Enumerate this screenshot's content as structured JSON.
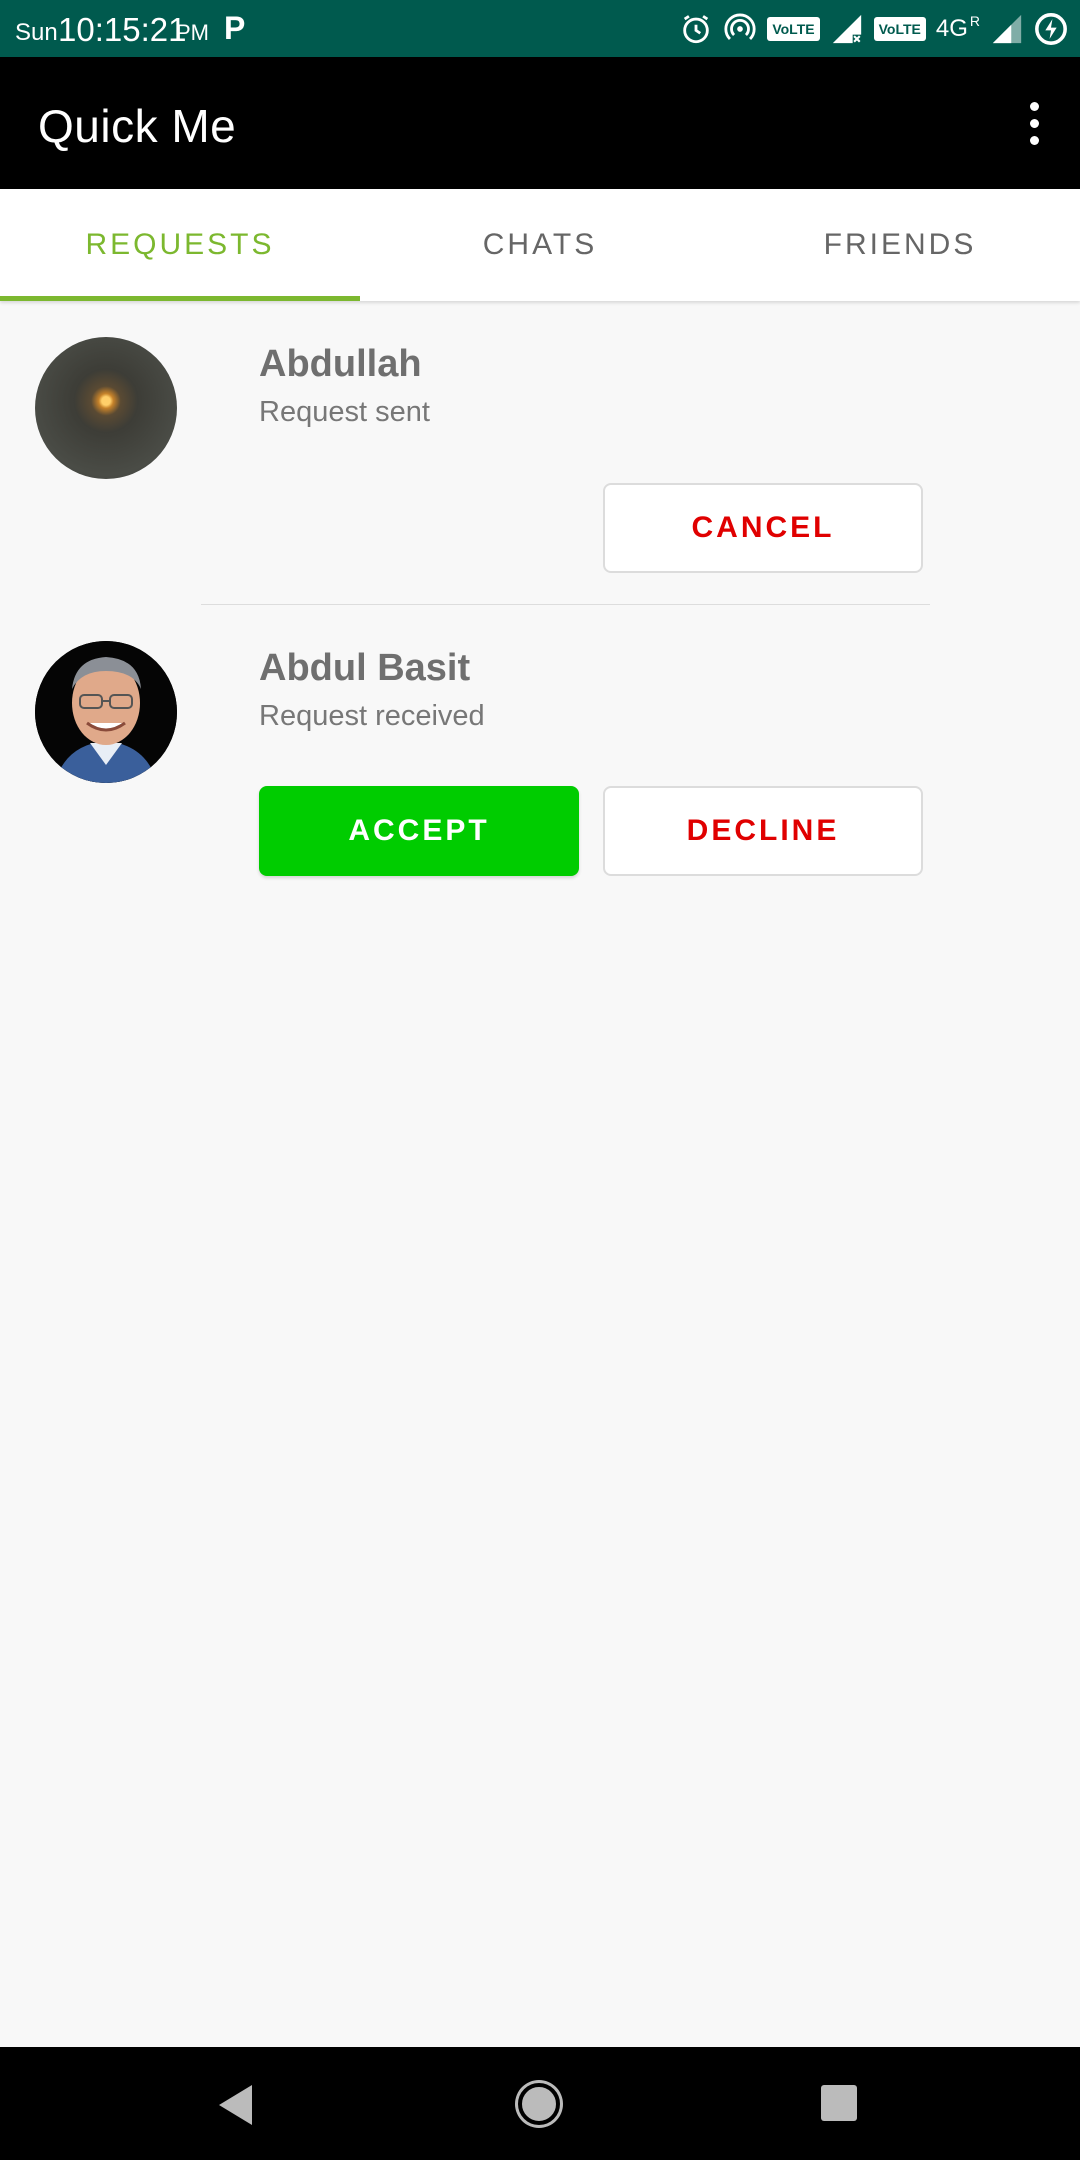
{
  "status_bar": {
    "day": "Sun",
    "time": "10:15:21",
    "ampm": "PM",
    "app_icon_letter": "P",
    "volte_1": "VoLTE",
    "volte_2": "VoLTE",
    "network": "4G",
    "roaming": "R"
  },
  "app_bar": {
    "title": "Quick Me",
    "menu_icon": "more-vert-icon"
  },
  "tabs": [
    {
      "label": "REQUESTS",
      "active": true
    },
    {
      "label": "CHATS",
      "active": false
    },
    {
      "label": "FRIENDS",
      "active": false
    }
  ],
  "requests": [
    {
      "name": "Abdullah",
      "status": "Request sent",
      "actions": [
        {
          "label": "CANCEL"
        }
      ]
    },
    {
      "name": "Abdul Basit",
      "status": "Request received",
      "actions": [
        {
          "label": "ACCEPT"
        },
        {
          "label": "DECLINE"
        }
      ]
    }
  ],
  "colors": {
    "status_bar": "#005a4e",
    "app_bar": "#000000",
    "accent": "#7cb82f",
    "accept": "#00cc00",
    "danger": "#e00000"
  }
}
